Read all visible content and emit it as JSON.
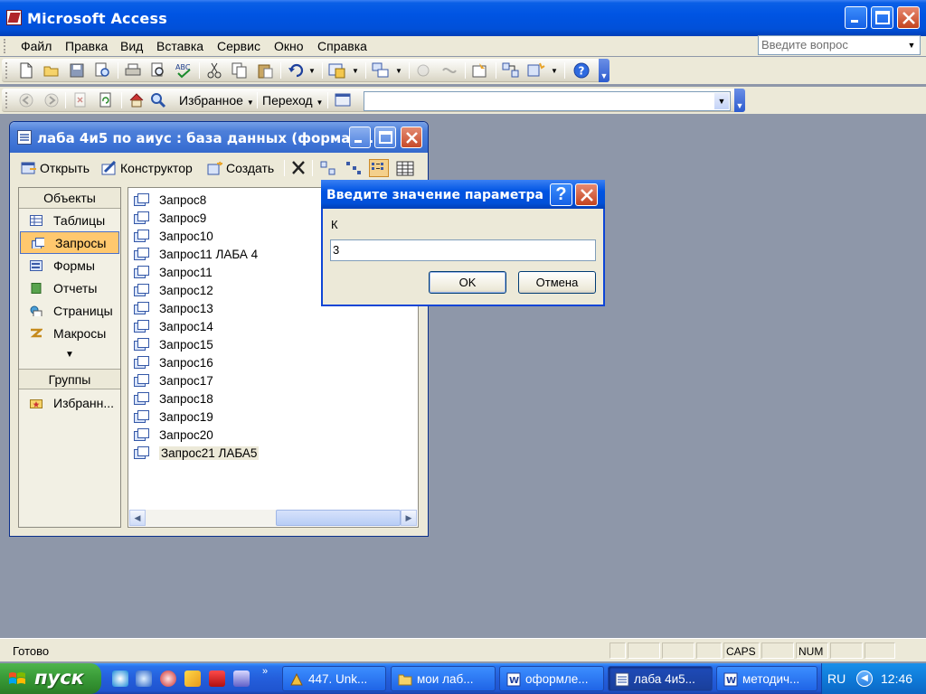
{
  "app": {
    "title": "Microsoft Access",
    "menu": [
      "Файл",
      "Правка",
      "Вид",
      "Вставка",
      "Сервис",
      "Окно",
      "Справка"
    ],
    "help_placeholder": "Введите вопрос",
    "web_toolbar": {
      "favorites": "Избранное",
      "goto": "Переход"
    }
  },
  "db_window": {
    "title": "лаба 4и5 по аиус : база данных (формат...",
    "toolbar": {
      "open": "Открыть",
      "design": "Конструктор",
      "create": "Создать"
    },
    "objects_header": "Объекты",
    "objects": [
      {
        "label": "Таблицы",
        "icon": "table-icon"
      },
      {
        "label": "Запросы",
        "icon": "query-icon",
        "selected": true
      },
      {
        "label": "Формы",
        "icon": "form-icon"
      },
      {
        "label": "Отчеты",
        "icon": "report-icon"
      },
      {
        "label": "Страницы",
        "icon": "page-icon"
      },
      {
        "label": "Макросы",
        "icon": "macro-icon"
      }
    ],
    "groups_header": "Группы",
    "groups": [
      {
        "label": "Избранн...",
        "icon": "favorites-folder-icon"
      }
    ],
    "items": [
      "Запрос8",
      "Запрос9",
      "Запрос10",
      "Запрос11 ЛАБА 4",
      "Запрос11",
      "Запрос12",
      "Запрос13",
      "Запрос14",
      "Запрос15",
      "Запрос16",
      "Запрос17",
      "Запрос18",
      "Запрос19",
      "Запрос20",
      "Запрос21 ЛАБА5"
    ],
    "selected_item": "Запрос21 ЛАБА5"
  },
  "dialog": {
    "title": "Введите значение параметра",
    "prompt": "К",
    "value": "3",
    "ok": "OK",
    "cancel": "Отмена"
  },
  "status": {
    "text": "Готово",
    "caps": "CAPS",
    "num": "NUM"
  },
  "taskbar": {
    "start": "пуск",
    "tasks": [
      {
        "label": "447. Unk...",
        "icon": "winamp-icon"
      },
      {
        "label": "мои лаб...",
        "icon": "folder-icon"
      },
      {
        "label": "оформле...",
        "icon": "word-icon"
      },
      {
        "label": "лаба 4и5...",
        "icon": "access-icon",
        "active": true
      },
      {
        "label": "методич...",
        "icon": "word-icon"
      }
    ],
    "lang": "RU",
    "clock": "12:46"
  },
  "colors": {
    "title_blue": "#0054e3",
    "desktop_gray": "#8e97a9",
    "face": "#ece9d8",
    "selection_orange": "#ffc86e",
    "taskbar_blue": "#245edb",
    "start_green": "#3c9e3a"
  }
}
